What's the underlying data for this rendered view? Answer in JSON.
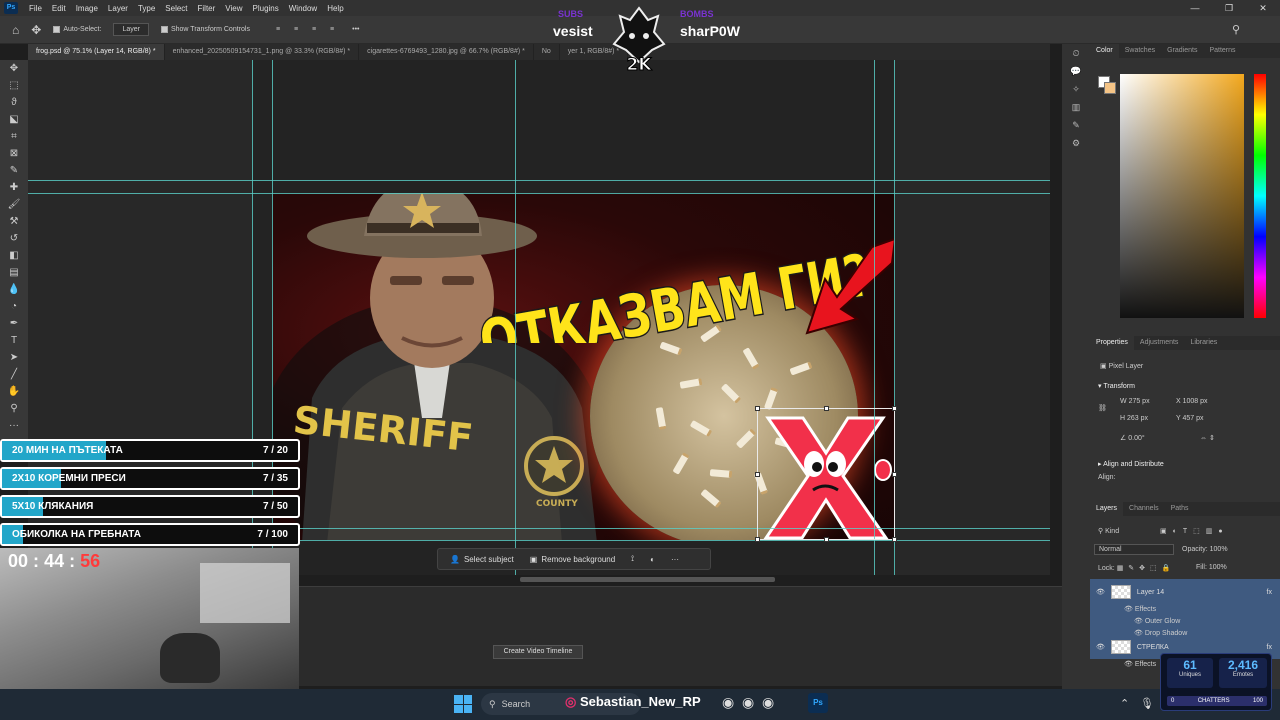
{
  "app": {
    "name": "Ps"
  },
  "menu": [
    "File",
    "Edit",
    "Image",
    "Layer",
    "Type",
    "Select",
    "Filter",
    "View",
    "Plugins",
    "Window",
    "Help"
  ],
  "window_controls": [
    "—",
    "❐",
    "✕"
  ],
  "options_bar": {
    "auto_select_label": "Auto-Select:",
    "auto_select_value": "Layer",
    "transform_controls_label": "Show Transform Controls",
    "more": "•••"
  },
  "tabs": [
    "frog.psd @ 75.1% (Layer 14, RGB/8) *",
    "enhanced_20250509154731_1.png @ 33.3% (RGB/8#) *",
    "cigarettes-6769493_1280.jpg @ 66.7% (RGB/8#) *",
    "No",
    "yer 1, RGB/8#) *"
  ],
  "overlay": {
    "subs_label": "SUBS",
    "subs_name": "vesist",
    "bombs_label": "BOMBS",
    "bombs_name": "sharP0W",
    "badge": "2K"
  },
  "thumbnail": {
    "headline": "ОТКАЗВАМ ГИ?",
    "vest_text": "SHERIFF",
    "patch_text": "COUNTY"
  },
  "context_bar": {
    "select_subject": "Select subject",
    "remove_background": "Remove background"
  },
  "timeline": {
    "create_button": "Create Video Timeline"
  },
  "right_panel": {
    "color_tabs": [
      "Color",
      "Swatches",
      "Gradients",
      "Patterns"
    ],
    "properties_tabs": [
      "Properties",
      "Adjustments",
      "Libraries"
    ],
    "layer_kind": "Pixel Layer",
    "transform_title": "Transform",
    "w_label": "W",
    "w_value": "275 px",
    "h_label": "H",
    "h_value": "263 px",
    "x_label": "X",
    "x_value": "1008 px",
    "y_label": "Y",
    "y_value": "457 px",
    "angle_value": "0.00°",
    "align_title": "Align and Distribute",
    "align_label": "Align:",
    "layers_tabs": [
      "Layers",
      "Channels",
      "Paths"
    ],
    "kind_label": "Kind",
    "blend_mode": "Normal",
    "opacity_label": "Opacity:",
    "opacity_value": "100%",
    "lock_label": "Lock:",
    "fill_label": "Fill:",
    "fill_value": "100%",
    "layers": [
      {
        "name": "Layer 14",
        "effects_label": "Effects",
        "effects": [
          "Outer Glow",
          "Drop Shadow"
        ]
      },
      {
        "name": "СТРЕЛКА",
        "effects_label": "Effects"
      }
    ],
    "fx": "fx"
  },
  "tasks": [
    {
      "label": "20 МИН НА ПЪТЕКАТА",
      "value": "7 / 20",
      "progress": 0.35
    },
    {
      "label": "2X10 КОРЕМНИ ПРЕСИ",
      "value": "7 / 35",
      "progress": 0.2
    },
    {
      "label": "5X10 КЛЯКАНИЯ",
      "value": "7 / 50",
      "progress": 0.14
    },
    {
      "label": "ОБИКОЛКА НА ГРЕБНАТА",
      "value": "7 / 100",
      "progress": 0.07
    }
  ],
  "timer": {
    "h": "00",
    "sep1": ":",
    "m": "44",
    "sep2": ":",
    "s": "56"
  },
  "taskbar": {
    "search_placeholder": "Search",
    "instagram_name": "Sebastian_New_RP"
  },
  "stats": {
    "uniques": "61",
    "uniques_label": "Uniques",
    "emotes": "2,416",
    "emotes_label": "Emotes",
    "bar_start": "0",
    "bar_label": "CHATTERS",
    "bar_end": "100"
  },
  "colors": {
    "accent_cyan": "#22a6c9",
    "headline_yellow": "#ffe41a",
    "x_red": "#f2304a",
    "timer_red": "#ff3b3b"
  }
}
